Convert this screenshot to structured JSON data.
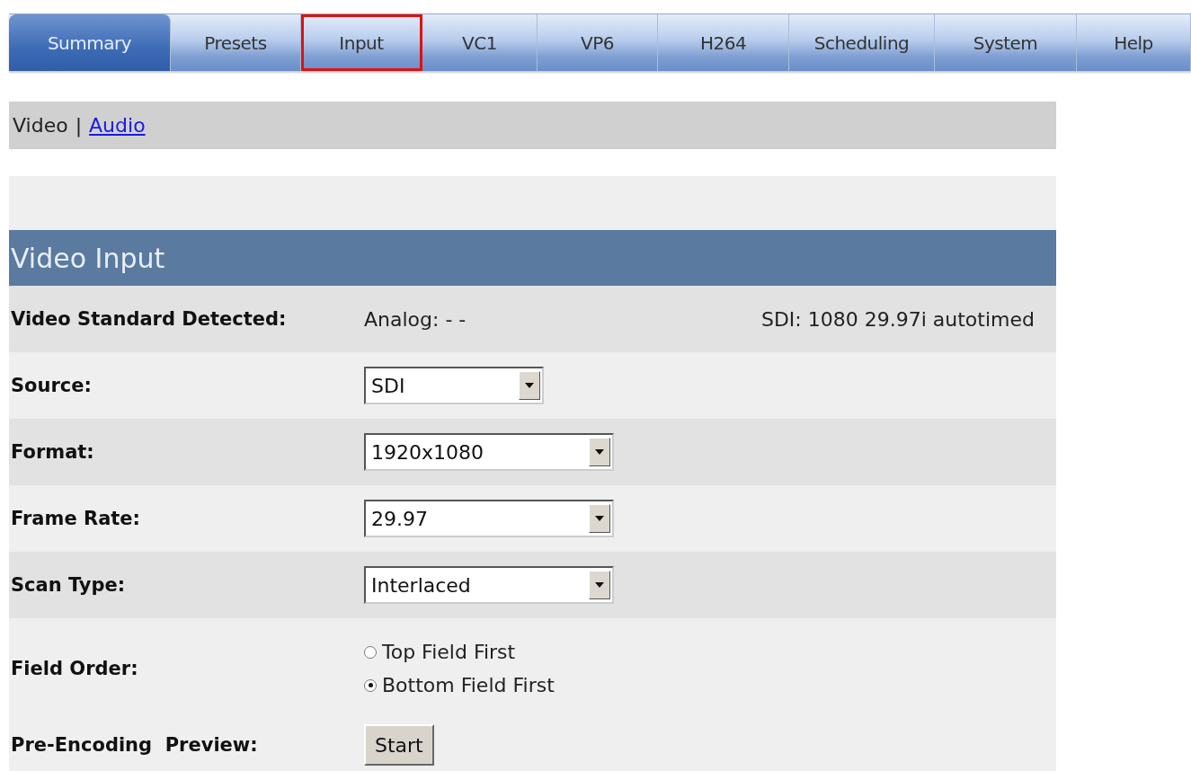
{
  "tabs": [
    {
      "label": "Summary",
      "selected": true,
      "highlighted": false
    },
    {
      "label": "Presets",
      "selected": false,
      "highlighted": false
    },
    {
      "label": "Input",
      "selected": false,
      "highlighted": true
    },
    {
      "label": "VC1",
      "selected": false,
      "highlighted": false
    },
    {
      "label": "VP6",
      "selected": false,
      "highlighted": false
    },
    {
      "label": "H264",
      "selected": false,
      "highlighted": false
    },
    {
      "label": "Scheduling",
      "selected": false,
      "highlighted": false
    },
    {
      "label": "System",
      "selected": false,
      "highlighted": false
    },
    {
      "label": "Help",
      "selected": false,
      "highlighted": false
    }
  ],
  "subnav": {
    "current": "Video",
    "separator": "|",
    "link": "Audio"
  },
  "section": {
    "title": "Video Input",
    "rows": [
      {
        "kind": "readout",
        "label": "Video Standard Detected:",
        "value": "Analog: - -",
        "value_right": "SDI: 1080 29.97i autotimed"
      },
      {
        "kind": "select",
        "label": "Source:",
        "value": "SDI"
      },
      {
        "kind": "select",
        "label": "Format:",
        "value": "1920x1080"
      },
      {
        "kind": "select",
        "label": "Frame Rate:",
        "value": "29.97"
      },
      {
        "kind": "select",
        "label": "Scan Type:",
        "value": "Interlaced"
      },
      {
        "kind": "radio",
        "label": "Field Order:",
        "options": [
          {
            "label": "Top Field First",
            "selected": false
          },
          {
            "label": "Bottom Field First",
            "selected": true
          }
        ]
      },
      {
        "kind": "button",
        "label": "Pre-Encoding  Preview:",
        "button": "Start"
      }
    ]
  }
}
